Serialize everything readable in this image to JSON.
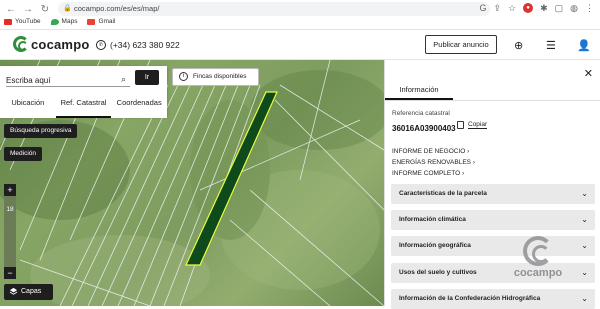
{
  "browser": {
    "url": "cocampo.com/es/es/map/",
    "bookmarks": [
      {
        "label": "YouTube",
        "color": "#e52d27"
      },
      {
        "label": "Maps",
        "color": "#34a853"
      },
      {
        "label": "Gmail",
        "color": "#ea4335"
      }
    ]
  },
  "header": {
    "brand": "cocampo",
    "phone": "(+34) 623 380 922",
    "publish_label": "Publicar anuncio",
    "accent": "#2f8f3a"
  },
  "search": {
    "placeholder": "Escriba aquí",
    "go_label": "Ir",
    "tabs": [
      "Ubicación",
      "Ref. Catastral",
      "Coordenadas"
    ],
    "active_tab": "Ref. Catastral"
  },
  "map": {
    "progressive_search_label": "Búsqueda progresiva",
    "measure_label": "Medición",
    "fincas_label": "Fincas disponibles",
    "zoom_level": "18",
    "zoom_in": "+",
    "zoom_out": "−",
    "layers_label": "Capas"
  },
  "panel": {
    "tab_label": "Información",
    "ref_label": "Referencia catastral",
    "ref_value": "36016A03900403",
    "copy_label": "Copiar",
    "links": [
      "INFORME DE NEGOCIO",
      "ENERGÍAS RENOVABLES",
      "INFORME COMPLETO"
    ],
    "sections": [
      "Características de la parcela",
      "Información climática",
      "Información geográfica",
      "Usos del suelo y cultivos",
      "Información de la Confederación Hidrográfica"
    ],
    "watermark": "cocampo"
  }
}
